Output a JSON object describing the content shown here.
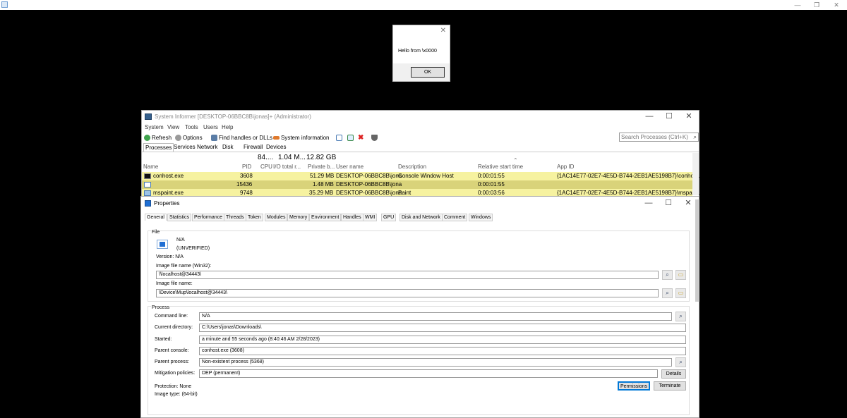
{
  "host": {
    "min_label": "—",
    "restore_label": "❐",
    "close_label": "✕"
  },
  "msgbox": {
    "close_label": "✕",
    "message": "Hello from \\x0000",
    "ok_label": "OK"
  },
  "si": {
    "title": "System Informer [DESKTOP-06BBC8B\\jonas]+ (Administrator)",
    "min_label": "—",
    "max_label": "☐",
    "close_label": "✕",
    "menu": [
      "System",
      "View",
      "Tools",
      "Users",
      "Help"
    ],
    "toolbar": {
      "refresh": "Refresh",
      "options": "Options",
      "find": "Find handles or DLLs",
      "sysinfo": "System information"
    },
    "search_placeholder": "Search Processes (Ctrl+K)",
    "tabs": [
      "Processes",
      "Services",
      "Network",
      "Disk",
      "Firewall",
      "Devices"
    ],
    "header": {
      "cpu_total": "84....",
      "io_total": "1.04 M...",
      "private_total": "12.82 GB",
      "columns": [
        "Name",
        "PID",
        "CPU",
        "I/O total r...",
        "Private b...",
        "User name",
        "Description",
        "Relative start time",
        "App ID"
      ]
    },
    "processes": [
      {
        "name": "conhost.exe",
        "pid": "3608",
        "cpu": "",
        "io": "",
        "private": "51.29 MB",
        "user": "DESKTOP-06BBC8B\\jona",
        "description": "Console Window Host",
        "start": "0:00:01:55",
        "app_id": "{1AC14E77-02E7-4E5D-B744-2EB1AE5198B7}\\conhost.exe"
      },
      {
        "name": "",
        "pid": "15436",
        "cpu": "",
        "io": "",
        "private": "1.48 MB",
        "user": "DESKTOP-06BBC8B\\jona",
        "description": "",
        "start": "0:00:01:55",
        "app_id": ""
      },
      {
        "name": "mspaint.exe",
        "pid": "9748",
        "cpu": "",
        "io": "",
        "private": "35.29 MB",
        "user": "DESKTOP-06BBC8B\\jona",
        "description": "Paint",
        "start": "0:00:03:56",
        "app_id": "{1AC14E77-02E7-4E5D-B744-2EB1AE5198B7}\\mspaint.exe"
      }
    ]
  },
  "props": {
    "title": "Properties",
    "min_label": "—",
    "max_label": "☐",
    "close_label": "✕",
    "tabs": [
      "General",
      "Statistics",
      "Performance",
      "Threads",
      "Token",
      "Modules",
      "Memory",
      "Environment",
      "Handles",
      "WMI",
      "GPU",
      "Disk and Network",
      "Comment",
      "Windows"
    ],
    "file": {
      "legend": "File",
      "name": "N/A",
      "verify": "(UNVERIFIED)",
      "version": "Version:  N/A",
      "win32_label": "Image file name (Win32):",
      "win32_value": "\\\\localhost@34443\\",
      "native_label": "Image file name:",
      "native_value": "\\Device\\Mup\\localhost@34443\\"
    },
    "process": {
      "legend": "Process",
      "cmdline_label": "Command line:",
      "cmdline": "N/A",
      "curdir_label": "Current directory:",
      "curdir": "C:\\Users\\jonas\\Downloads\\",
      "started_label": "Started:",
      "started": "a minute and 55 seconds ago (8:40:46 AM 2/28/2023)",
      "pconsole_label": "Parent console:",
      "pconsole": "conhost.exe (3608)",
      "pprocess_label": "Parent process:",
      "pprocess": "Non-existent process (5368)",
      "mitigation_label": "Mitigation policies:",
      "mitigation": "DEP (permanent)",
      "details_label": "Details",
      "protection": "Protection:  None",
      "image_type": "Image type:  (64-bit)",
      "permissions_label": "Permissions",
      "terminate_label": "Terminate"
    }
  },
  "colors": {
    "highlight": "#f6f2a0",
    "selected": "#d9d37a",
    "accent": "#0078d7"
  }
}
